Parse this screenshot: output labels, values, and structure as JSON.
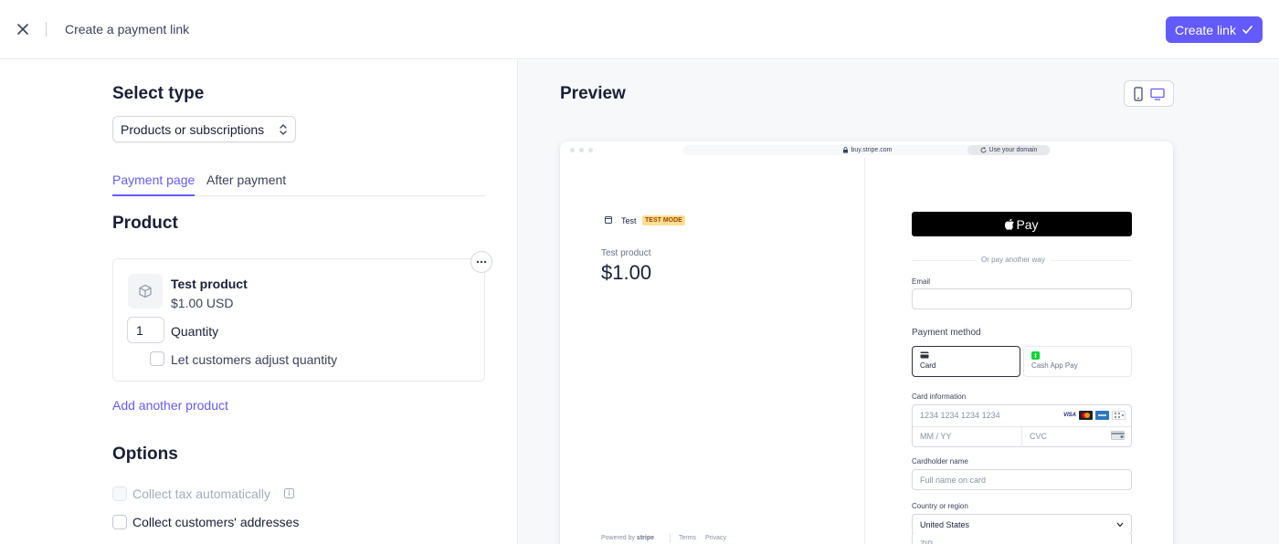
{
  "header": {
    "title": "Create a payment link",
    "create_label": "Create link"
  },
  "left": {
    "select_type_title": "Select type",
    "type_value": "Products or subscriptions",
    "tabs": [
      {
        "label": "Payment page",
        "active": true
      },
      {
        "label": "After payment",
        "active": false
      }
    ],
    "product_title": "Product",
    "product": {
      "name": "Test product",
      "price": "$1.00 USD",
      "quantity": "1",
      "quantity_label": "Quantity",
      "adjust_label": "Let customers adjust quantity"
    },
    "add_product": "Add another product",
    "options_title": "Options",
    "options": [
      {
        "label": "Collect tax automatically",
        "disabled": true
      },
      {
        "label": "Collect customers' addresses",
        "disabled": false
      }
    ]
  },
  "preview": {
    "title": "Preview",
    "url": "buy.stripe.com",
    "use_domain": "Use your domain",
    "merchant": "Test",
    "test_mode": "TEST MODE",
    "product_name": "Test product",
    "amount": "$1.00",
    "powered_by": "Powered by",
    "stripe": "stripe",
    "terms": "Terms",
    "privacy": "Privacy",
    "apple_pay": "Pay",
    "or_pay": "Or pay another way",
    "email_label": "Email",
    "payment_method_label": "Payment method",
    "methods": [
      {
        "label": "Card",
        "selected": true
      },
      {
        "label": "Cash App Pay",
        "selected": false
      }
    ],
    "card_info_label": "Card information",
    "card_number_placeholder": "1234 1234 1234 1234",
    "expiry_placeholder": "MM / YY",
    "cvc_placeholder": "CVC",
    "card_brand_visa": "VISA",
    "cardholder_label": "Cardholder name",
    "cardholder_placeholder": "Full name on card",
    "country_label": "Country or region",
    "country_value": "United States",
    "zip_placeholder": "ZIP"
  },
  "colors": {
    "accent": "#635bff",
    "text": "#1a1f36",
    "muted": "#697386",
    "border": "#e6e8eb",
    "test_badge": "#ffde92"
  },
  "icons": [
    "close-icon",
    "checkmark-icon",
    "chevron-updown-icon",
    "box-icon",
    "more-icon",
    "info-icon",
    "mobile-icon",
    "desktop-icon",
    "lock-icon",
    "refresh-icon",
    "window-icon",
    "apple-icon",
    "card-icon",
    "cash-app-icon",
    "chevron-down-icon"
  ]
}
